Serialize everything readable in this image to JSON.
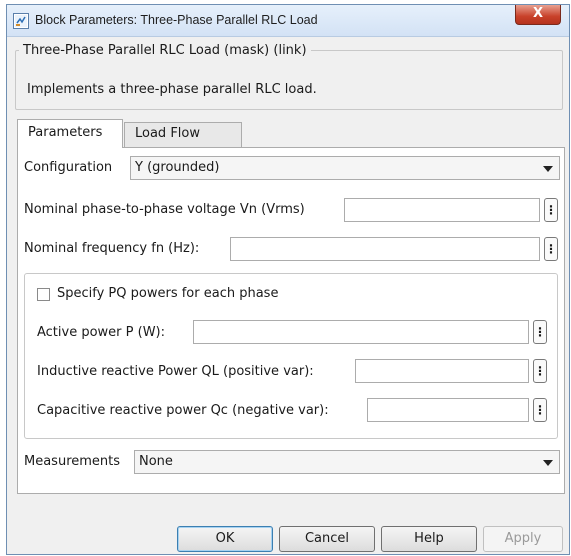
{
  "window": {
    "title": "Block Parameters: Three-Phase Parallel RLC Load",
    "close_glyph": "X"
  },
  "description": {
    "legend": "Three-Phase Parallel RLC Load (mask) (link)",
    "text": "Implements a three-phase parallel RLC load."
  },
  "tabs": [
    {
      "label": "Parameters",
      "active": true
    },
    {
      "label": "Load Flow",
      "active": false
    }
  ],
  "parameters": {
    "configuration": {
      "label": "Configuration",
      "value": "Y (grounded)"
    },
    "nominal_voltage": {
      "label": "Nominal phase-to-phase voltage Vn (Vrms)",
      "value": ""
    },
    "nominal_frequency": {
      "label": "Nominal frequency fn (Hz):",
      "value": ""
    },
    "specify_pq": {
      "label": "Specify PQ powers for each phase",
      "checked": false
    },
    "active_power": {
      "label": "Active power P (W):",
      "value": ""
    },
    "inductive_power": {
      "label": "Inductive reactive Power QL (positive var):",
      "value": ""
    },
    "capacitive_power": {
      "label": "Capacitive reactive power Qc (negative var):",
      "value": ""
    },
    "measurements": {
      "label": "Measurements",
      "value": "None"
    }
  },
  "dots_glyph": "⋮",
  "buttons": {
    "ok": "OK",
    "cancel": "Cancel",
    "help": "Help",
    "apply": "Apply"
  },
  "icons": [
    "simulink-block-icon",
    "close-icon",
    "chevron-down-icon",
    "ellipsis-icon"
  ],
  "colors": {
    "title_gradient_top": "#e6f0fb",
    "close_red": "#c8412a",
    "panel_bg": "#ffffff",
    "dialog_bg": "#f0f0f0"
  }
}
